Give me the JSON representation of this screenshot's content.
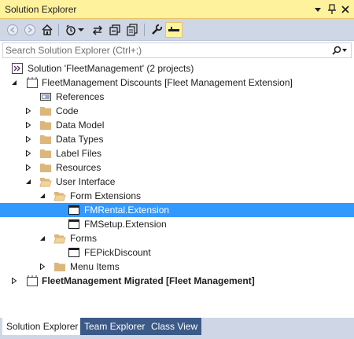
{
  "window": {
    "title": "Solution Explorer"
  },
  "search": {
    "placeholder": "Search Solution Explorer (Ctrl+;)"
  },
  "tree": {
    "solution": "Solution 'FleetManagement' (2 projects)",
    "project1": "FleetManagement Discounts [Fleet Management Extension]",
    "references": "References",
    "code": "Code",
    "data_model": "Data Model",
    "data_types": "Data Types",
    "label_files": "Label Files",
    "resources": "Resources",
    "user_interface": "User Interface",
    "form_extensions": "Form Extensions",
    "fm_rental_extension": "FMRental.Extension",
    "fm_setup_extension": "FMSetup.Extension",
    "forms": "Forms",
    "fe_pick_discount": "FEPickDiscount",
    "menu_items": "Menu Items",
    "project2": "FleetManagement Migrated [Fleet Management]"
  },
  "tabs": {
    "solution_explorer": "Solution Explorer",
    "team_explorer": "Team Explorer",
    "class_view": "Class View"
  },
  "colors": {
    "accent_title": "#fff29d",
    "selection": "#3399ff",
    "toolbar": "#cfd6e5",
    "tab_inactive": "#3c5a88",
    "folder": "#dcb67a"
  }
}
